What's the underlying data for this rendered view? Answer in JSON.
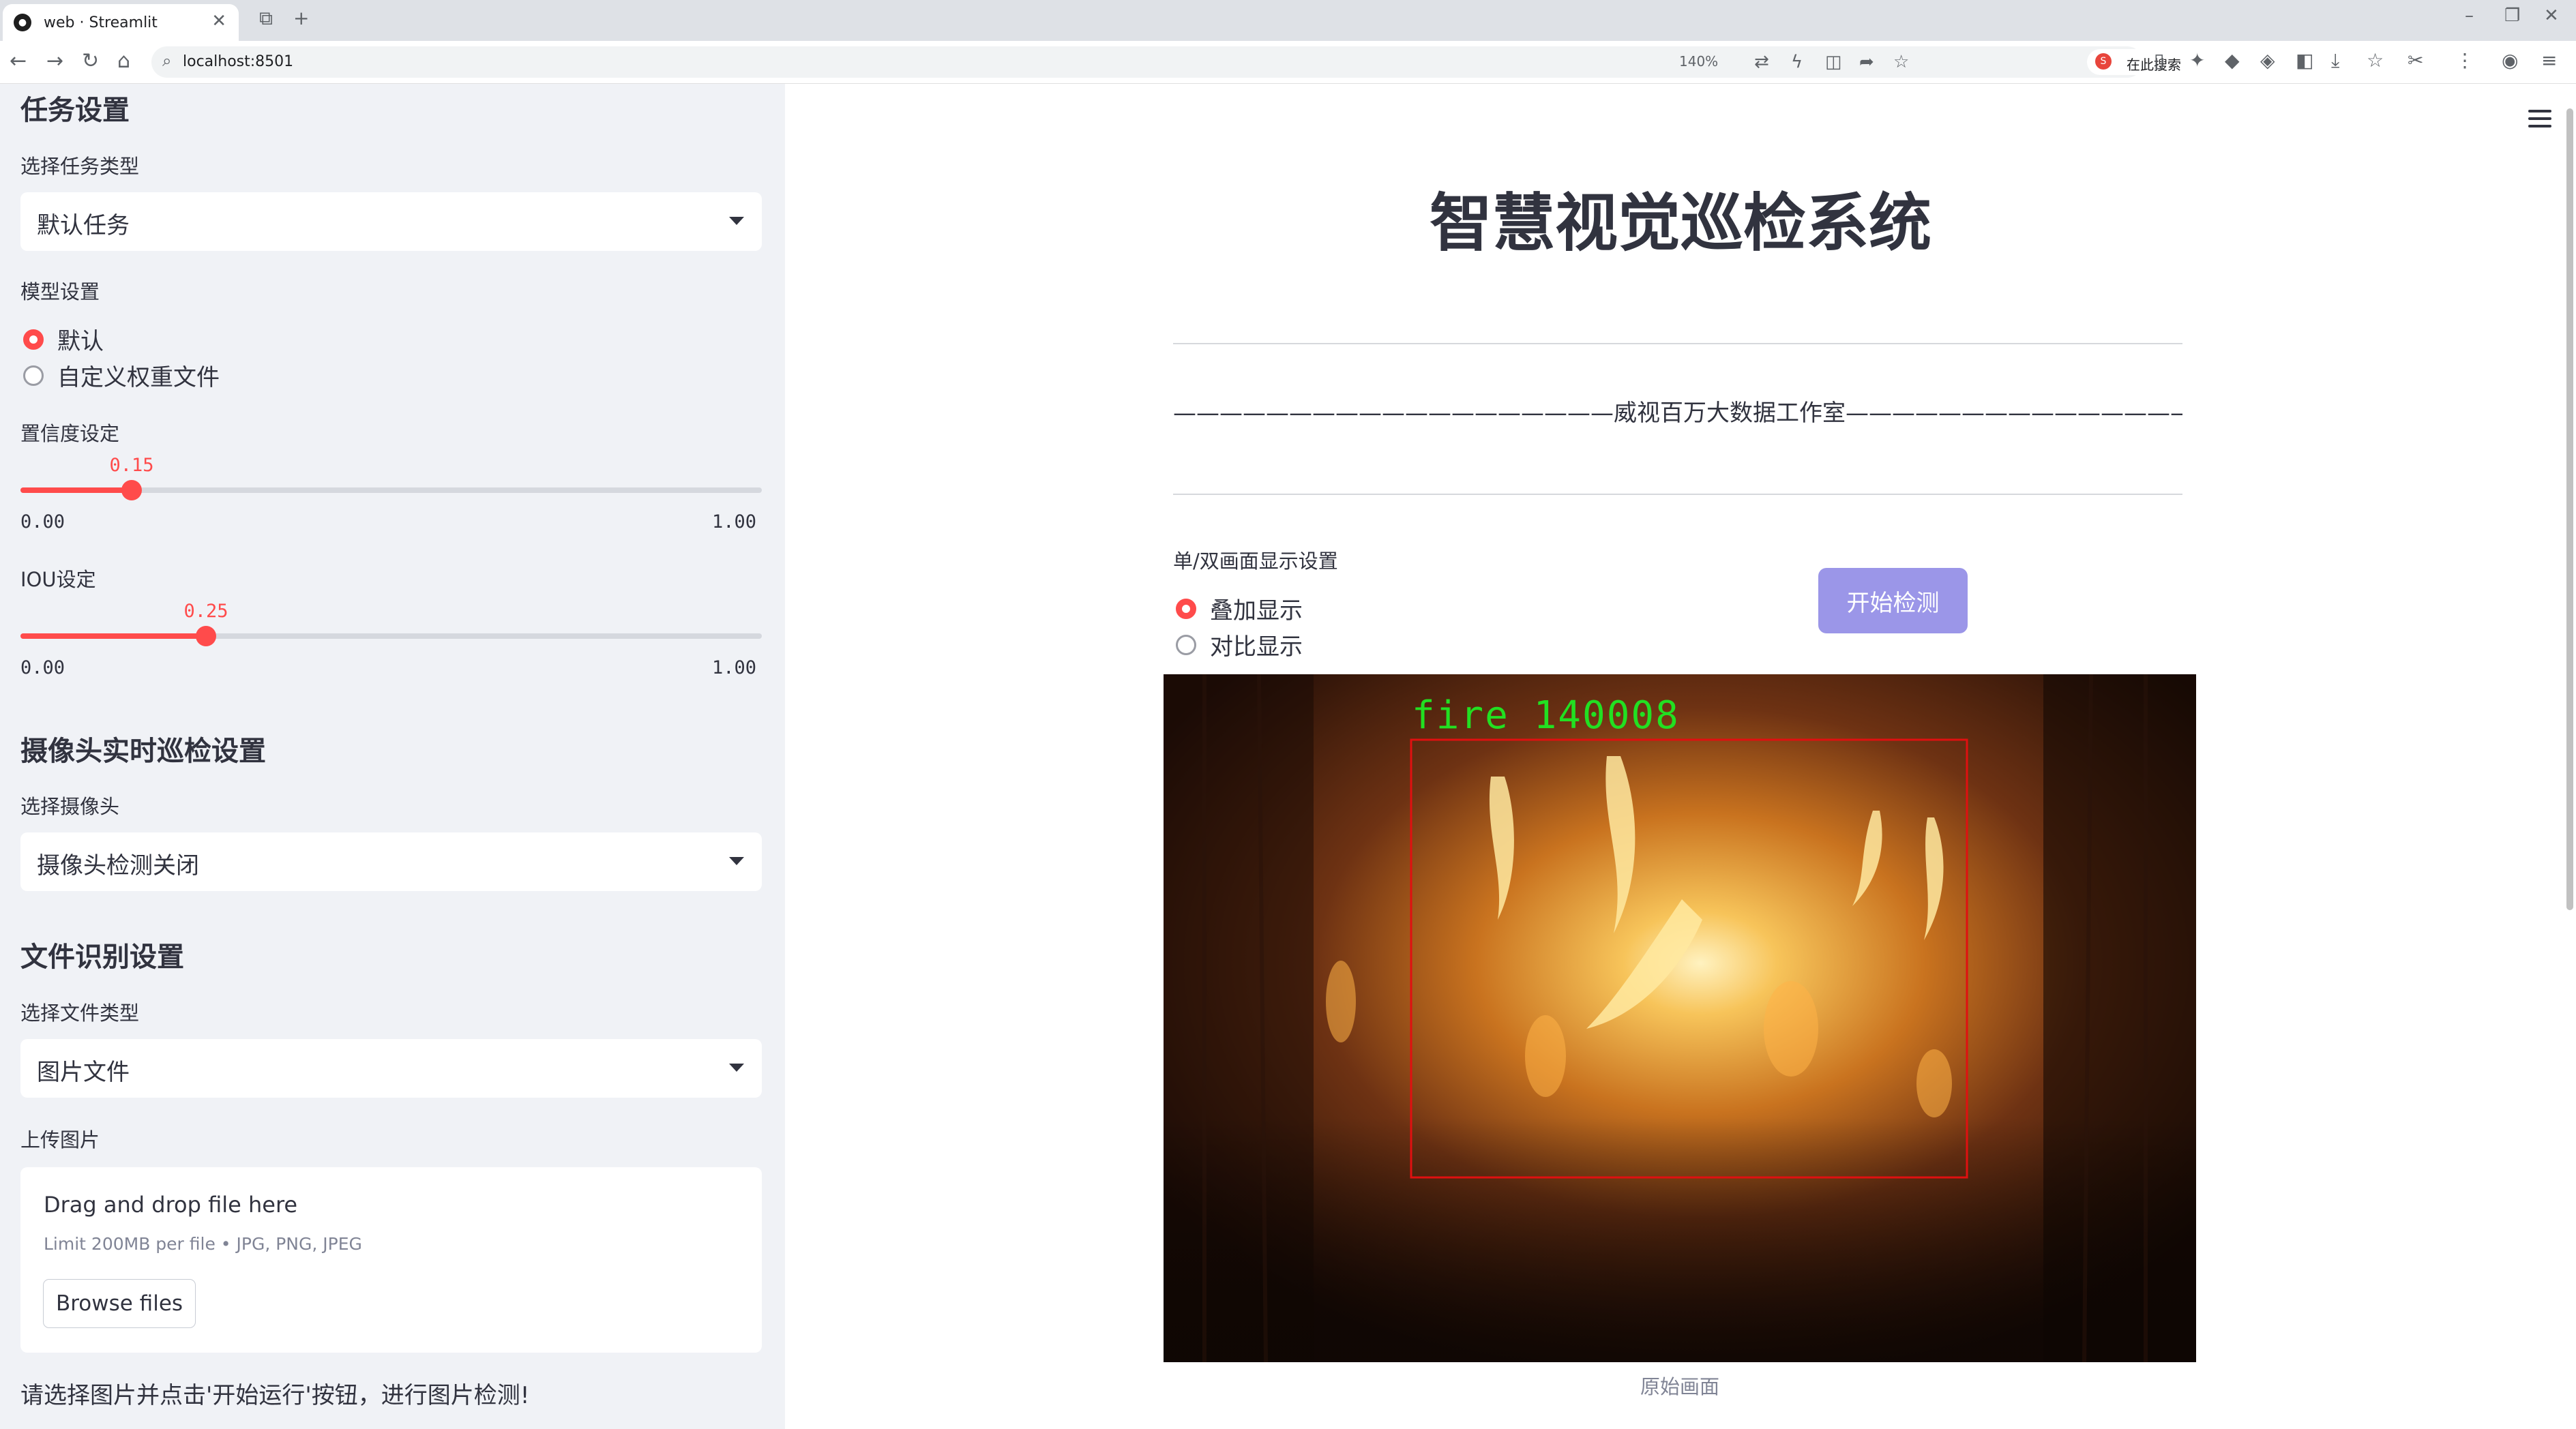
{
  "browser": {
    "tab_title": "web · Streamlit",
    "url": "localhost:8501",
    "zoom": "140%",
    "search_placeholder": "在此搜索"
  },
  "sidebar": {
    "task_section_title": "任务设置",
    "task_type_label": "选择任务类型",
    "task_type_value": "默认任务",
    "model_label": "模型设置",
    "model_options": [
      {
        "label": "默认",
        "checked": true
      },
      {
        "label": "自定义权重文件",
        "checked": false
      }
    ],
    "confidence": {
      "label": "置信度设定",
      "value": 0.15,
      "display": "0.15",
      "min": "0.00",
      "max": "1.00"
    },
    "iou": {
      "label": "IOU设定",
      "value": 0.25,
      "display": "0.25",
      "min": "0.00",
      "max": "1.00"
    },
    "camera_section_title": "摄像头实时巡检设置",
    "camera_label": "选择摄像头",
    "camera_value": "摄像头检测关闭",
    "file_section_title": "文件识别设置",
    "file_type_label": "选择文件类型",
    "file_type_value": "图片文件",
    "upload_label": "上传图片",
    "uploader": {
      "title": "Drag and drop file here",
      "limit": "Limit 200MB per file • JPG, PNG, JPEG",
      "button": "Browse files"
    },
    "note": "请选择图片并点击'开始运行'按钮，进行图片检测!"
  },
  "main": {
    "title": "智慧视觉巡检系统",
    "subtitle": "———————————————————威视百万大数据工作室————————————————————",
    "display_label": "单/双画面显示设置",
    "display_options": [
      {
        "label": "叠加显示",
        "checked": true
      },
      {
        "label": "对比显示",
        "checked": false
      }
    ],
    "start_button": "开始检测",
    "detection_label": "fire 140008",
    "image_caption": "原始画面",
    "colors": {
      "accent": "#ff4b4b",
      "button": "#9b96e8",
      "box": "#e01010",
      "label": "#22e022"
    }
  }
}
